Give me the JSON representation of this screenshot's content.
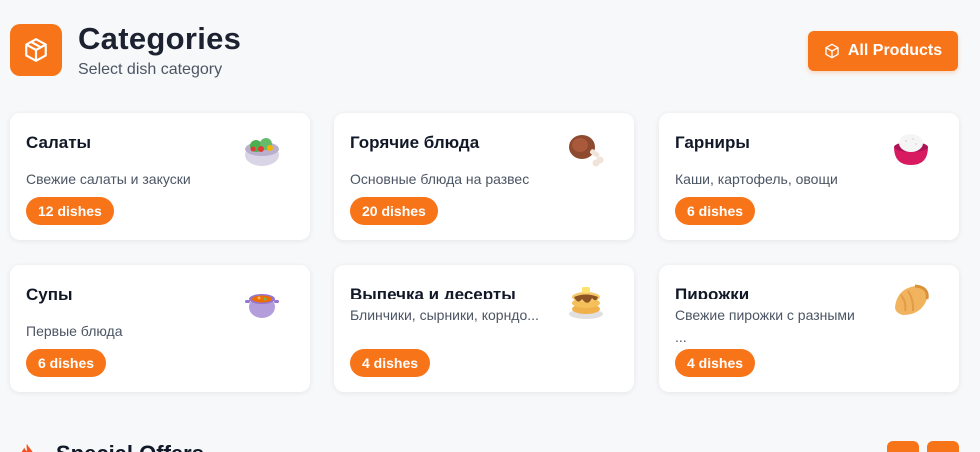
{
  "header": {
    "title": "Categories",
    "subtitle": "Select dish category",
    "all_products_label": "All Products",
    "logo_icon": "box-icon"
  },
  "colors": {
    "accent": "#f77418",
    "background": "#f7f8fa",
    "card": "#ffffff"
  },
  "categories": [
    {
      "title": "Салаты",
      "desc": "Свежие салаты и закуски",
      "badge": "12 dishes",
      "icon": "salad-icon"
    },
    {
      "title": "Горячие блюда",
      "desc": "Основные блюда на развес",
      "badge": "20 dishes",
      "icon": "meat-icon"
    },
    {
      "title": "Гарниры",
      "desc": "Каши, картофель, овощи",
      "badge": "6 dishes",
      "icon": "rice-bowl-icon"
    },
    {
      "title": "Супы",
      "desc": "Первые блюда",
      "badge": "6 dishes",
      "icon": "soup-pot-icon"
    },
    {
      "title": "Выпечка и десерты",
      "desc": "Блинчики, сырники, корндо...",
      "badge": "4 dishes",
      "icon": "pancakes-icon"
    },
    {
      "title": "Пирожки",
      "desc": "Свежие пирожки с разными ...",
      "badge": "4 dishes",
      "icon": "dumpling-icon"
    }
  ],
  "special": {
    "title": "Special Offers",
    "icon": "fire-icon"
  }
}
